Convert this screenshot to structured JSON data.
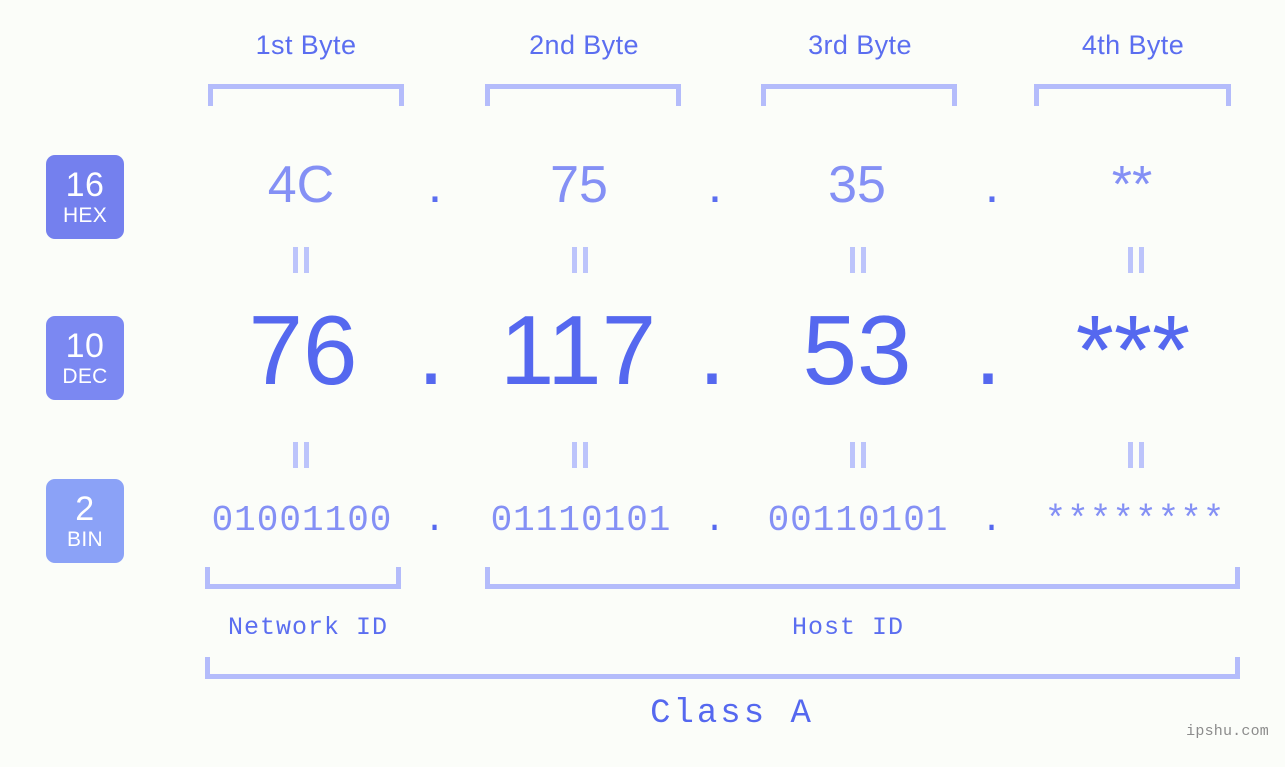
{
  "background_color": "#fbfdf9",
  "accent_color": "#5568ef",
  "accent_light_color": "#8490f5",
  "bracket_color": "#b4bcfb",
  "byte_headers": [
    {
      "label": "1st Byte"
    },
    {
      "label": "2nd Byte"
    },
    {
      "label": "3rd Byte"
    },
    {
      "label": "4th Byte"
    }
  ],
  "rows": [
    {
      "badge_number": "16",
      "badge_abbr": "HEX",
      "badge_color": "#7480ee",
      "values": [
        "4C",
        "75",
        "35",
        "**"
      ],
      "separator": "."
    },
    {
      "badge_number": "10",
      "badge_abbr": "DEC",
      "badge_color": "#7b88f2",
      "values": [
        "76",
        "117",
        "53",
        "***"
      ],
      "separator": "."
    },
    {
      "badge_number": "2",
      "badge_abbr": "BIN",
      "badge_color": "#8ba2f7",
      "values": [
        "01001100",
        "01110101",
        "00110101",
        "********"
      ],
      "separator": "."
    }
  ],
  "equals_symbol": "=",
  "id_sections": [
    {
      "label": "Network ID"
    },
    {
      "label": "Host ID"
    }
  ],
  "class_label": "Class A",
  "watermark": "ipshu.com"
}
